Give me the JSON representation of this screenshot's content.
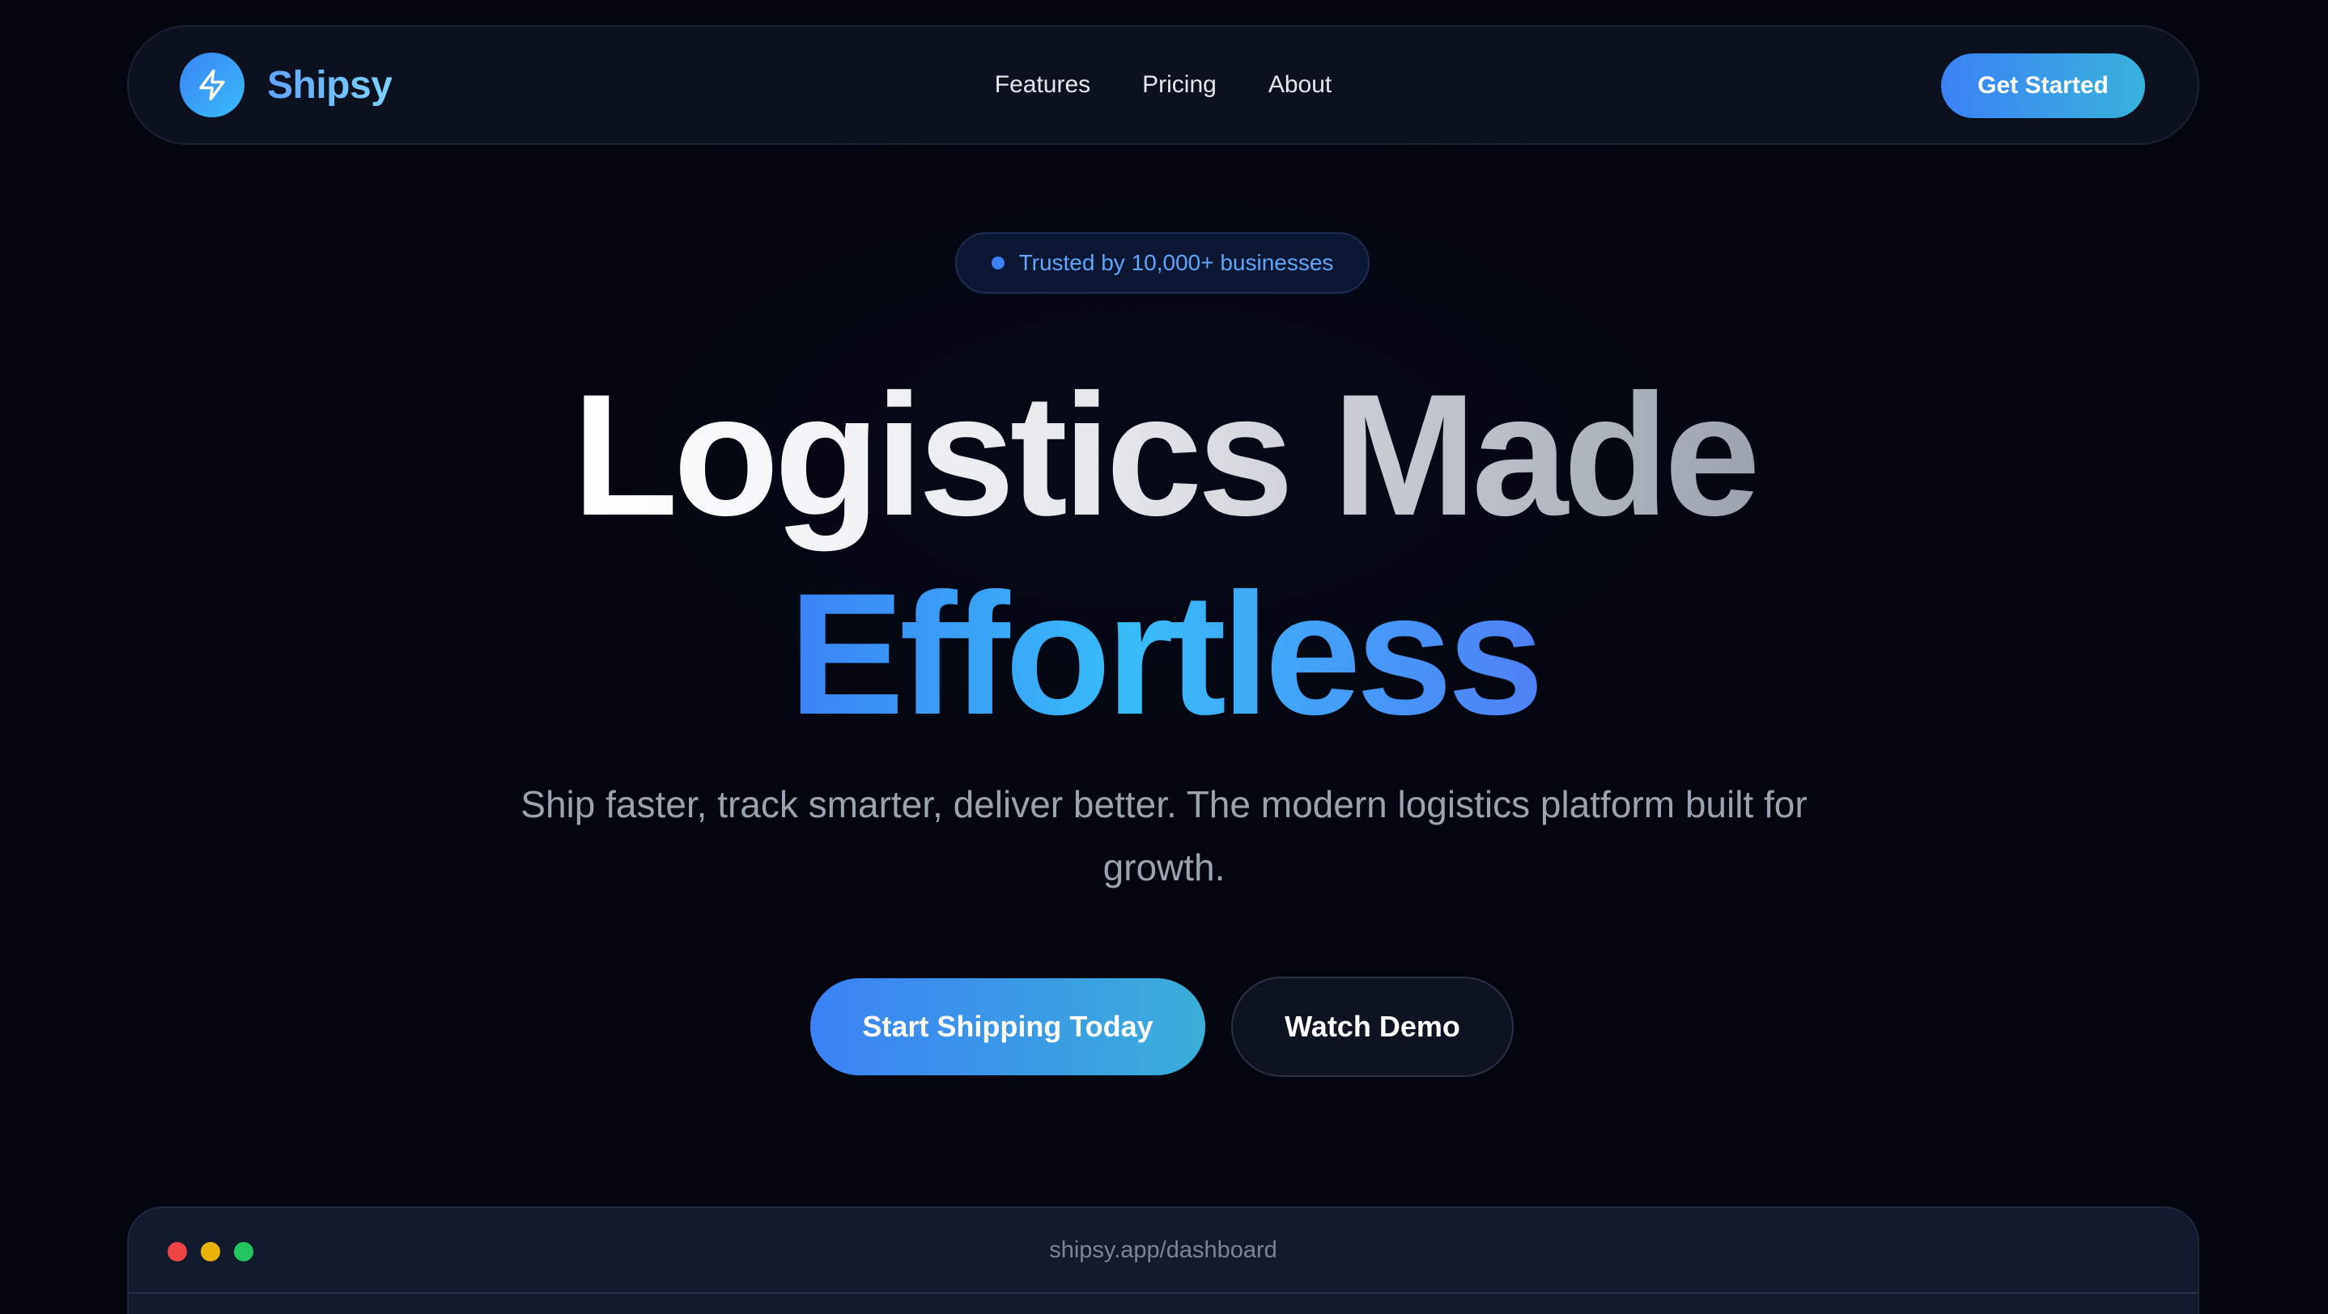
{
  "nav": {
    "brand": "Shipsy",
    "logo_icon": "lightning-bolt-icon",
    "links": [
      "Features",
      "Pricing",
      "About"
    ],
    "cta_label": "Get Started"
  },
  "hero": {
    "badge_text": "Trusted by 10,000+ businesses",
    "headline_line1": "Logistics Made",
    "headline_line2": "Effortless",
    "subtitle": "Ship faster, track smarter, deliver better. The modern logistics platform built for growth.",
    "primary_cta": "Start Shipping Today",
    "secondary_cta": "Watch Demo"
  },
  "preview": {
    "url": "shipsy.app/dashboard"
  },
  "colors": {
    "background": "#03060f",
    "accent_blue": "#3b82f6",
    "accent_cyan": "#38bdf8",
    "muted_text": "#9ca3af"
  }
}
